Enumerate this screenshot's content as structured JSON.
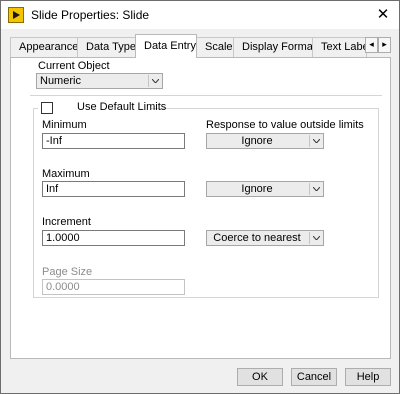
{
  "window": {
    "title": "Slide Properties: Slide",
    "close_glyph": "✕"
  },
  "tabs": [
    {
      "label": "Appearance",
      "active": false
    },
    {
      "label": "Data Type",
      "active": false
    },
    {
      "label": "Data Entry",
      "active": true
    },
    {
      "label": "Scale",
      "active": false
    },
    {
      "label": "Display Format",
      "active": false
    },
    {
      "label": "Text Label",
      "active": false
    }
  ],
  "tab_scroll": {
    "left_glyph": "◂",
    "right_glyph": "▸"
  },
  "current_object": {
    "label": "Current Object",
    "value": "Numeric"
  },
  "default_limits": {
    "label": "Use Default Limits",
    "checked": false
  },
  "minimum": {
    "label": "Minimum",
    "value": "-Inf",
    "response": "Ignore"
  },
  "response_header": "Response to value outside limits",
  "maximum": {
    "label": "Maximum",
    "value": "Inf",
    "response": "Ignore"
  },
  "increment": {
    "label": "Increment",
    "value": "1.0000",
    "response": "Coerce to nearest"
  },
  "page_size": {
    "label": "Page Size",
    "value": "0.0000",
    "enabled": false
  },
  "buttons": {
    "ok": "OK",
    "cancel": "Cancel",
    "help": "Help"
  },
  "icons": {
    "app": "labview-slide-icon",
    "close": "close-icon",
    "dropdown": "chevron-down-icon"
  }
}
